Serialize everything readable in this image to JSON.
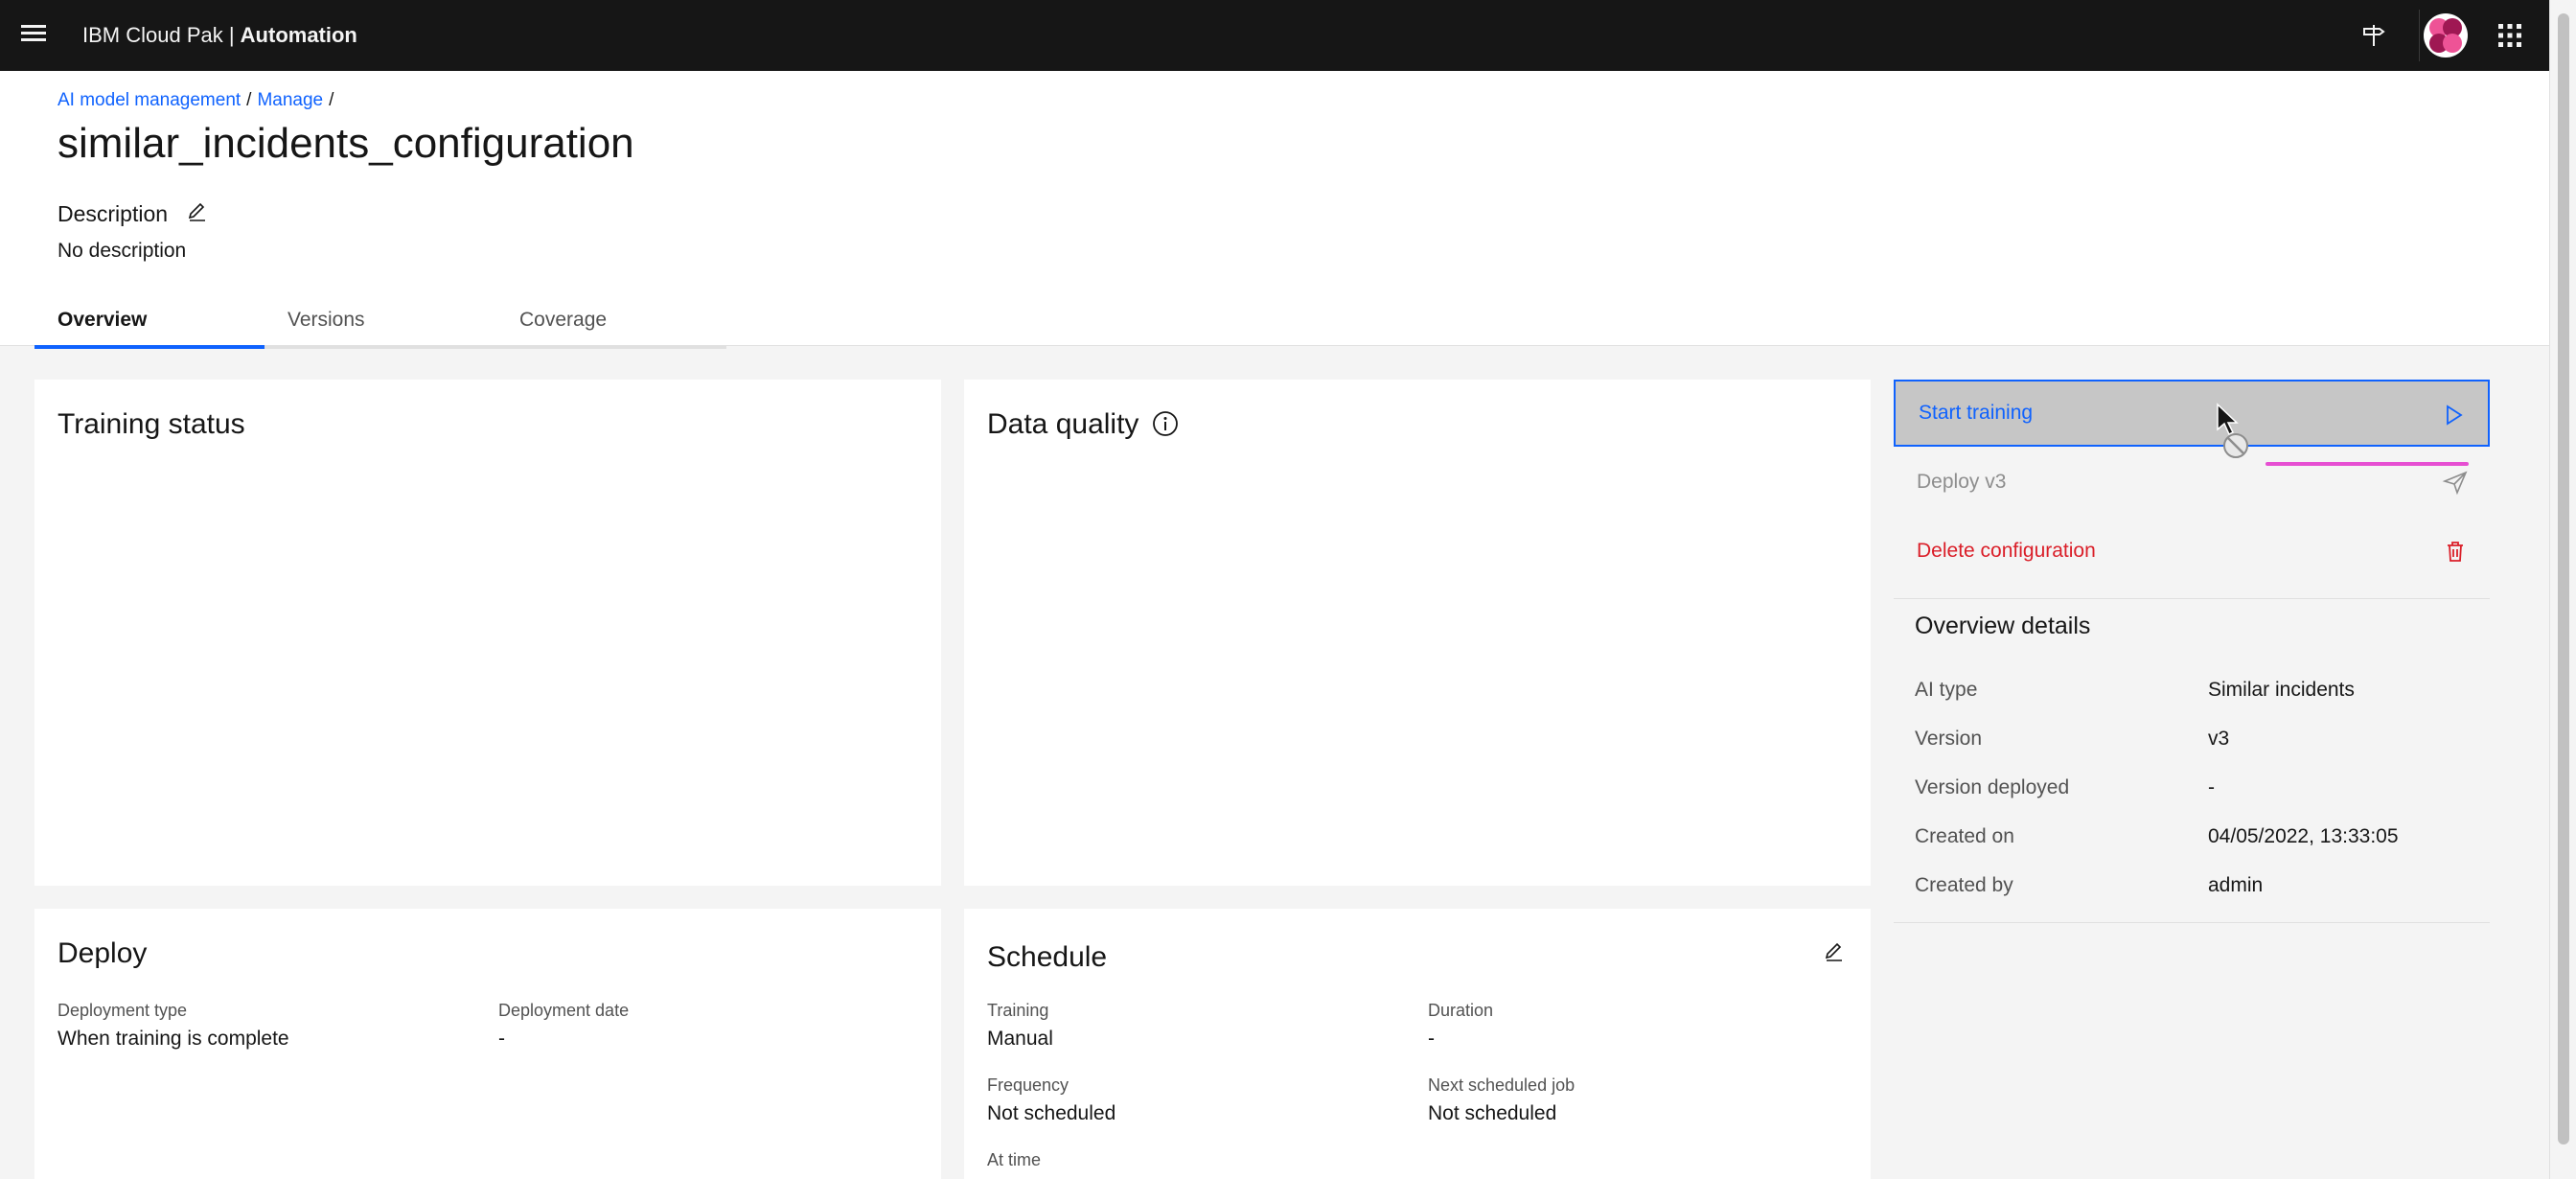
{
  "header": {
    "brand_prefix": "IBM Cloud Pak | ",
    "brand_product": "Automation",
    "icons": [
      "menu-icon",
      "signpost-icon",
      "avatar-icon",
      "app-switcher-icon"
    ]
  },
  "breadcrumb": {
    "items": [
      "AI model management",
      "Manage"
    ],
    "separator": "/"
  },
  "page": {
    "title": "similar_incidents_configuration",
    "description_label": "Description",
    "description_text": "No description"
  },
  "tabs": [
    {
      "label": "Overview",
      "active": true
    },
    {
      "label": "Versions",
      "active": false
    },
    {
      "label": "Coverage",
      "active": false
    }
  ],
  "cards": {
    "training_status": {
      "title": "Training status"
    },
    "data_quality": {
      "title": "Data quality"
    },
    "deploy": {
      "title": "Deploy",
      "fields": [
        {
          "label": "Deployment type",
          "value": "When training is complete"
        },
        {
          "label": "Deployment date",
          "value": "-"
        }
      ]
    },
    "schedule": {
      "title": "Schedule",
      "fields": [
        {
          "label": "Training",
          "value": "Manual"
        },
        {
          "label": "Duration",
          "value": "-"
        },
        {
          "label": "Frequency",
          "value": "Not scheduled"
        },
        {
          "label": "Next scheduled job",
          "value": "Not scheduled"
        },
        {
          "label": "At time",
          "value": ""
        }
      ]
    }
  },
  "actions": [
    {
      "label": "Start training",
      "icon": "play-icon"
    },
    {
      "label": "Deploy v3",
      "icon": "send-icon",
      "disabled": true
    },
    {
      "label": "Delete configuration",
      "icon": "trash-icon"
    }
  ],
  "overview_details": {
    "title": "Overview details",
    "rows": [
      {
        "label": "AI type",
        "value": "Similar incidents"
      },
      {
        "label": "Version",
        "value": "v3"
      },
      {
        "label": "Version deployed",
        "value": "-"
      },
      {
        "label": "Created on",
        "value": "04/05/2022, 13:33:05"
      },
      {
        "label": "Created by",
        "value": "admin"
      }
    ]
  },
  "colors": {
    "link": "#0f62fe",
    "danger": "#da1e28",
    "header_bg": "#161616",
    "page_bg": "#f4f4f4",
    "drag_indicator": "#e64fd2"
  }
}
